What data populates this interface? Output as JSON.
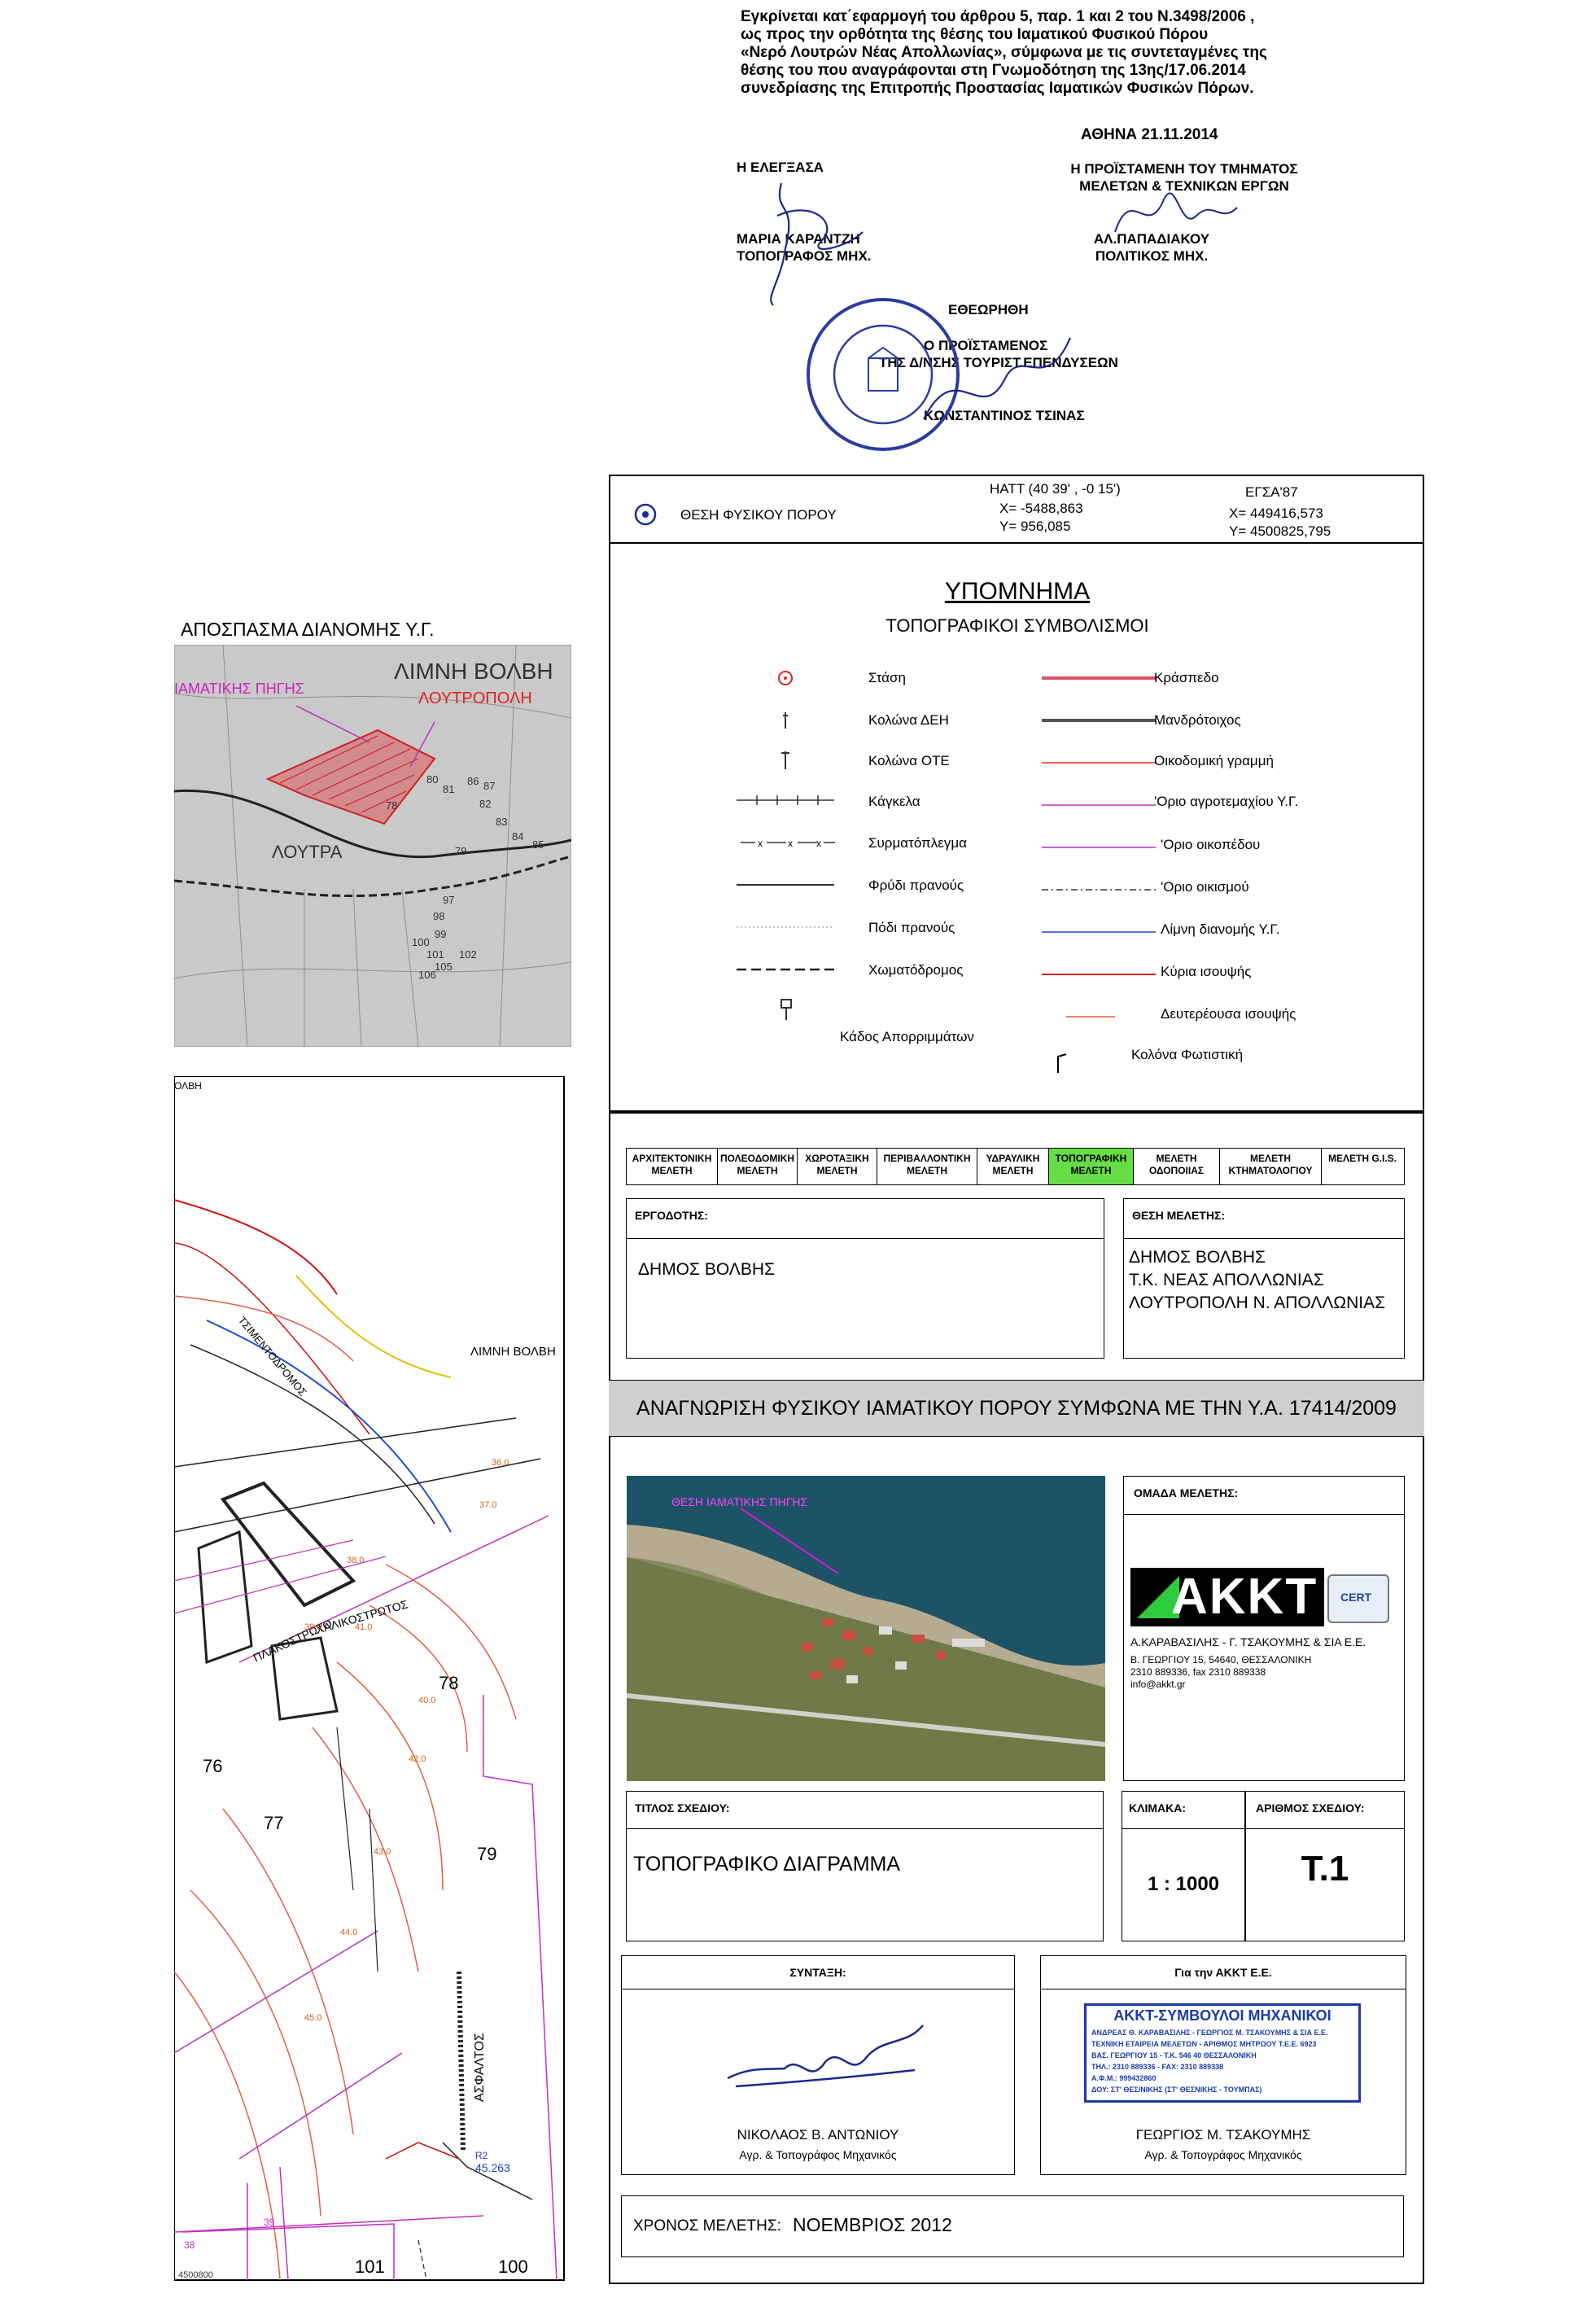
{
  "approval": {
    "lines": [
      "Εγκρίνεται κατ΄εφαρμογή του άρθρου 5, παρ. 1 και 2 του Ν.3498/2006 ,",
      "ως προς την ορθότητα της θέσης του Ιαματικού Φυσικού Πόρου",
      "«Νερό Λουτρών Νέας Απολλωνίας», σύμφωνα με τις συντεταγμένες της",
      "θέσης του που αναγράφονται στη Γνωμοδότηση της 13ης/17.06.2014",
      "συνεδρίασης της Επιτροπής Προστασίας Ιαματικών Φυσικών Πόρων."
    ],
    "date": "ΑΘΗΝΑ 21.11.2014",
    "checked_title": "Η ΕΛΕΓΞΑΣΑ",
    "checked_name": "ΜΑΡΙΑ ΚΑΡΑΝΤΖΗ",
    "checked_role": "ΤΟΠΟΓΡΑΦΟΣ ΜΗΧ.",
    "head_title_1": "Η ΠΡΟΪΣΤΑΜΕΝΗ ΤΟΥ ΤΜΗΜΑΤΟΣ",
    "head_title_2": "ΜΕΛΕΤΩΝ & ΤΕΧΝΙΚΩΝ ΕΡΓΩΝ",
    "head_name": "ΑΛ.ΠΑΠΑΔΙΑΚΟΥ",
    "head_role": "ΠΟΛΙΤΙΚΟΣ ΜΗΧ.",
    "approved_title": "ΕΘΕΩΡΗΘΗ",
    "director_1": "Ο ΠΡΟΪΣΤΑΜΕΝΟΣ",
    "director_2": "ΤΗΣ Δ/ΝΣΗΣ ΤΟΥΡΙΣΤ.ΕΠΕΝΔΥΣΕΩΝ",
    "director_name": "ΚΩΝΣΤΑΝΤΙΝΟΣ ΤΣΙΝΑΣ"
  },
  "coords": {
    "label": "ΘΕΣΗ ΦΥΣΙΚΟΥ ΠΟΡΟΥ",
    "hatt_title": "HATT  (40 39' ,  -0 15')",
    "hatt_x": "X= -5488,863",
    "hatt_y": "Y= 956,085",
    "egsa_title": "ΕΓΣΑ'87",
    "egsa_x": "X= 449416,573",
    "egsa_y": "Y= 4500825,795"
  },
  "legend": {
    "title": "ΥΠΟΜΝΗΜΑ",
    "subtitle": "ΤΟΠΟΓΡΑΦΙΚΟΙ ΣΥΜΒΟΛΙΣΜΟΙ",
    "left": [
      "Στάση",
      "Κολώνα ΔΕΗ",
      "Κολώνα ΟΤΕ",
      "Κάγκελα",
      "Συρματόπλεγμα",
      "Φρύδι πρανούς",
      "Πόδι πρανούς",
      "Χωματόδρομος",
      "Κάδος Απορριμμάτων"
    ],
    "right": [
      "Κράσπεδο",
      "Μανδρότοιχος",
      "Οικοδομική γραμμή",
      "'Οριο αγροτεμαχίου Υ.Γ.",
      "'Οριο οικοπέδου",
      "'Οριο οικισμού",
      "Λίμνη διανομής Υ.Γ.",
      "Κύρια ισουψής",
      "Δευτερέουσα ισουψής",
      "Κολόνα Φωτιστική"
    ],
    "right_colors": [
      "#e0506a",
      "#555555",
      "#e03030",
      "#c030c0",
      "#b030d0",
      "#333333",
      "#2040d0",
      "#d02020",
      "#e06040",
      "#000000"
    ]
  },
  "excerpt": {
    "title": "ΑΠΟΣΠΑΣΜΑ ΔΙΑΝΟΜΗΣ Υ.Γ.",
    "lake": "ΛΙΜΝΗ ΒΟΛΒΗ",
    "spring": "ΙΑΜΑΤΙΚΗΣ ΠΗΓΗΣ",
    "town": "ΛΟΥΤΡΟΠΟΛΗ",
    "area": "ΛΟΥΤΡΑ",
    "parcel_numbers": [
      "78",
      "79",
      "80",
      "81",
      "82",
      "83",
      "84",
      "85",
      "86",
      "87",
      "97",
      "98",
      "99",
      "100",
      "101",
      "102",
      "105",
      "106"
    ]
  },
  "studies": {
    "tabs": [
      "ΑΡΧΙΤΕΚΤΟΝΙΚΗ ΜΕΛΕΤΗ",
      "ΠΟΛΕΟΔΟΜΙΚΗ ΜΕΛΕΤΗ",
      "ΧΩΡΟΤΑΞΙΚΗ ΜΕΛΕΤΗ",
      "ΠΕΡΙΒΑΛΛΟΝΤΙΚΗ ΜΕΛΕΤΗ",
      "ΥΔΡΑΥΛΙΚΗ ΜΕΛΕΤΗ",
      "ΤΟΠΟΓΡΑΦΙΚΗ ΜΕΛΕΤΗ",
      "ΜΕΛΕΤΗ ΟΔΟΠΟΙΙΑΣ",
      "ΜΕΛΕΤΗ ΚΤΗΜΑΤΟΛΟΓΙΟΥ",
      "ΜΕΛΕΤΗ G.I.S."
    ],
    "active_index": 5,
    "active_color": "#66dd44"
  },
  "client": {
    "label": "ΕΡΓΟΔΟΤΗΣ:",
    "value": "ΔΗΜΟΣ ΒΟΛΒΗΣ"
  },
  "location": {
    "label": "ΘΕΣΗ ΜΕΛΕΤΗΣ:",
    "line1": "ΔΗΜΟΣ ΒΟΛΒΗΣ",
    "line2": "Τ.Κ. ΝΕΑΣ ΑΠΟΛΛΩΝΙΑΣ",
    "line3": "ΛΟΥΤΡΟΠΟΛΗ Ν. ΑΠΟΛΛΩΝΙΑΣ"
  },
  "project_title": "ΑΝΑΓΝΩΡΙΣΗ ΦΥΣΙΚΟΥ ΙΑΜΑΤΙΚΟΥ ΠΟΡΟΥ ΣΥΜΦΩΝΑ ΜΕ ΤΗΝ Υ.Α. 17414/2009",
  "photo": {
    "label": "ΘΕΣΗ ΙΑΜΑΤΙΚΗΣ ΠΗΓΗΣ"
  },
  "team": {
    "label": "ΟΜΑΔΑ ΜΕΛΕΤΗΣ:",
    "logo": "AKKT",
    "cert": "CERT",
    "company": "Α.ΚΑΡΑΒΑΣΙΛΗΣ - Γ. ΤΣΑΚΟΥΜΗΣ  & ΣΙΑ Ε.Ε.",
    "address": "Β. ΓΕΩΡΓΙΟΥ 15, 54640, ΘΕΣΣΑΛΟΝΙΚΗ",
    "phone": "2310 889336, fax 2310 889338",
    "email": "info@akkt.gr"
  },
  "drawing": {
    "title_label": "ΤΙΤΛΟΣ ΣΧΕΔΙΟΥ:",
    "title": "ΤΟΠΟΓΡΑΦΙΚΟ ΔΙΑΓΡΑΜΜΑ",
    "scale_label": "ΚΛΙΜΑΚΑ:",
    "scale": "1 : 1000",
    "number_label": "ΑΡΙΘΜΟΣ ΣΧΕΔΙΟΥ:",
    "number": "Τ.1"
  },
  "signatures": {
    "composed_label": "ΣΥΝΤΑΞΗ:",
    "composer_name": "ΝΙΚΟΛΑΟΣ Β. ΑΝΤΩΝΙΟΥ",
    "composer_role": "Αγρ. & Τοπογράφος Μηχανικός",
    "company_label": "Για την ΑΚΚΤ Ε.Ε.",
    "signer_name": "ΓΕΩΡΓΙΟΣ Μ. ΤΣΑΚΟΥΜΗΣ",
    "signer_role": "Αγρ. & Τοπογράφος Μηχανικός",
    "stamp_title": "ΑΚΚΤ-ΣΥΜΒΟΥΛΟΙ ΜΗΧΑΝΙΚΟΙ",
    "stamp_lines": [
      "ΑΝΔΡΕΑΣ Θ. ΚΑΡΑΒΑΣΙΛΗΣ - ΓΕΩΡΓΙΟΣ Μ. ΤΣΑΚΟΥΜΗΣ & ΣΙΑ Ε.Ε.",
      "ΤΕΧΝΙΚΗ ΕΤΑΙΡΕΙΑ ΜΕΛΕΤΩΝ - ΑΡΙΘΜΟΣ ΜΗΤΡΩΟΥ Τ.Ε.Ε. 6923",
      "ΒΑΣ. ΓΕΩΡΓΙΟΥ 15 - Τ.Κ. 546 40 ΘΕΣΣΑΛΟΝΙΚΗ",
      "ΤΗΛ.: 2310 889336 - FAX: 2310 889338",
      "Α.Φ.Μ.: 999432860",
      "ΔΟΥ: ΣΤ' ΘΕΣ/ΝΙΚΗΣ (ΣΤ' ΘΕΣΝΙΚΗΣ - ΤΟΥΜΠΑΣ)"
    ]
  },
  "study_date": {
    "label": "ΧΡΟΝΟΣ ΜΕΛΕΤΗΣ:",
    "value": "ΝΟΕΜΒΡΙΟΣ 2012"
  },
  "plan": {
    "lake_label": "ΛΙΜΝΗ ΒΟΛΒΗ",
    "corner_label": "ΟΛΒΗ",
    "road_1": "ΤΣΙΜΕΝΤΟΔΡΟΜΟΣ",
    "road_2": "ΠΛΑΚΟΣΤΡΩΤΟ",
    "road_3": "ΧΑΛΙΚΟΣΤΡΩΤΟΣ",
    "road_4": "ΑΣΦΑΛΤΟΣ",
    "parcels": [
      "78",
      "76",
      "77",
      "79",
      "101",
      "100",
      "39",
      "38"
    ],
    "contours": [
      "36.0",
      "37.0",
      "38.0",
      "39.0",
      "40.0",
      "41.0",
      "42.0",
      "43.0",
      "44.0",
      "45.0"
    ],
    "point_label": "R2",
    "point_value": "45.263",
    "corner_coord": "4500800"
  }
}
